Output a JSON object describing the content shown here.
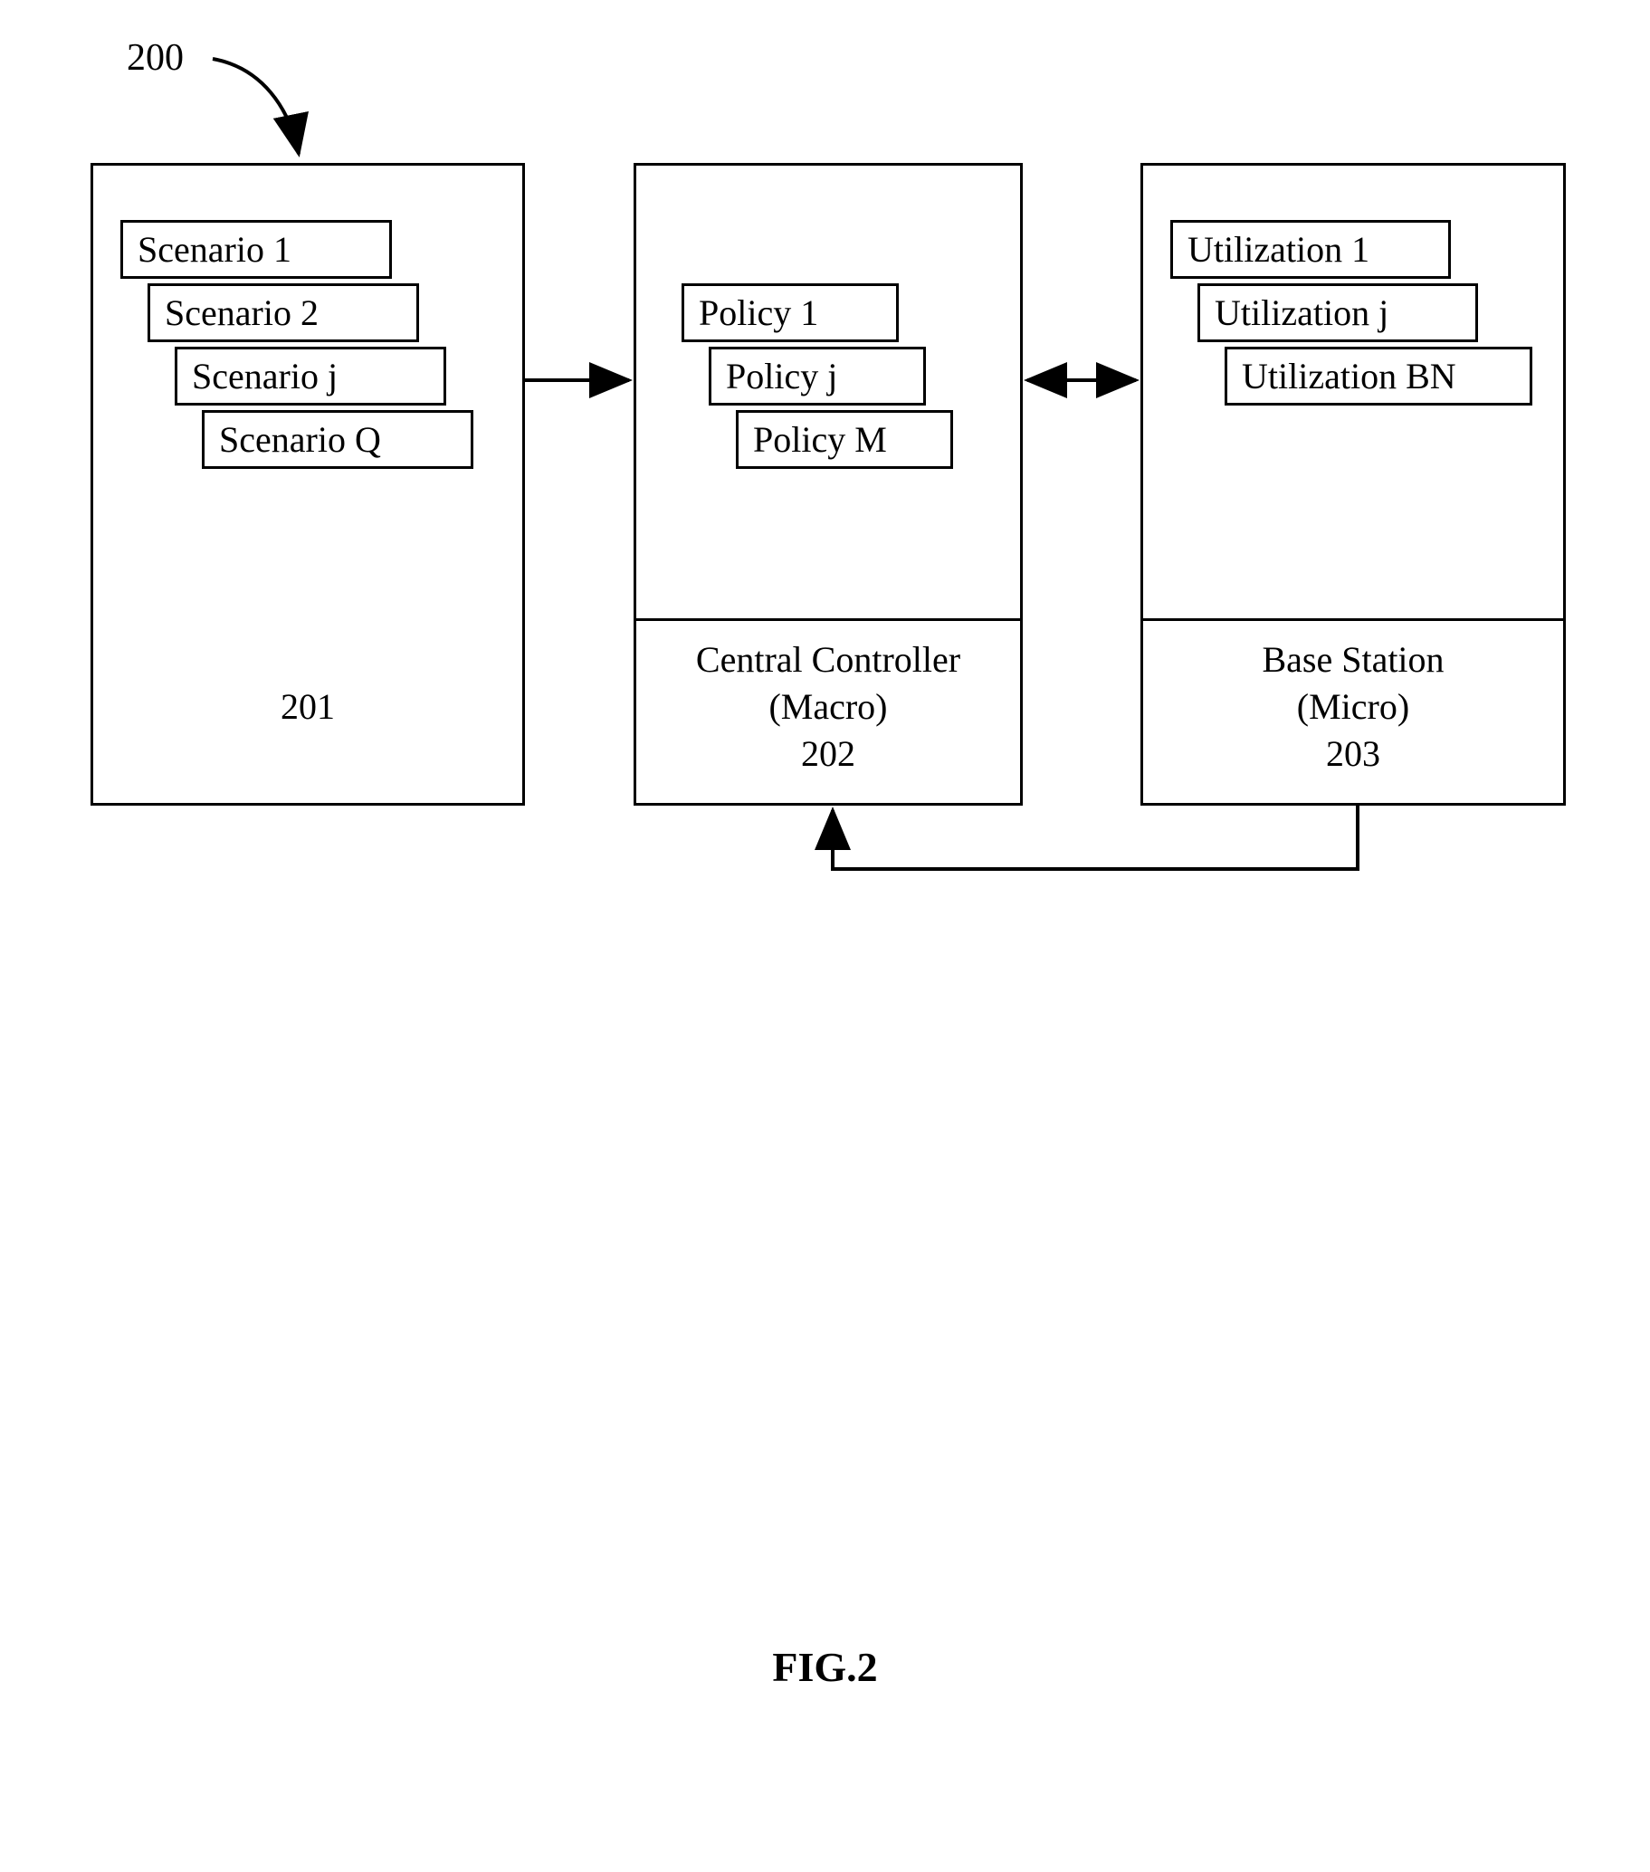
{
  "figure_number": "200",
  "figure_caption": "FIG.2",
  "block1": {
    "cards": [
      "Scenario 1",
      "Scenario 2",
      "Scenario j",
      "Scenario Q"
    ],
    "footer_lines": [
      "201"
    ]
  },
  "block2": {
    "cards": [
      "Policy 1",
      "Policy j",
      "Policy M"
    ],
    "footer_lines": [
      "Central Controller",
      "(Macro)",
      "202"
    ]
  },
  "block3": {
    "cards": [
      "Utilization 1",
      "Utilization j",
      "Utilization BN"
    ],
    "footer_lines": [
      "Base Station",
      "(Micro)",
      "203"
    ]
  }
}
